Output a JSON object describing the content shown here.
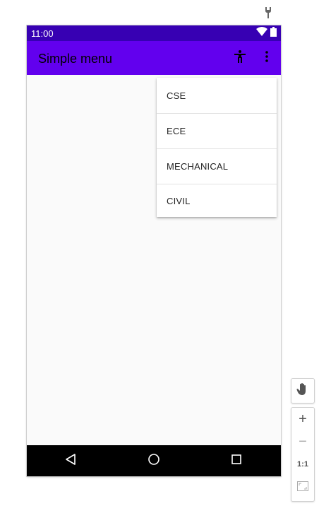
{
  "status_bar": {
    "time": "11:00",
    "wifi_icon": "wifi-icon",
    "battery_icon": "battery-icon"
  },
  "app_bar": {
    "title": "Simple menu",
    "accessibility_icon": "accessibility-icon",
    "overflow_icon": "more-vert-icon"
  },
  "menu": {
    "items": [
      {
        "label": "CSE"
      },
      {
        "label": "ECE"
      },
      {
        "label": "MECHANICAL"
      },
      {
        "label": "CIVIL"
      }
    ]
  },
  "nav_bar": {
    "back_icon": "back-triangle-icon",
    "home_icon": "home-circle-icon",
    "recents_icon": "recents-square-icon"
  },
  "emulator_tools": {
    "wrench_icon": "wrench-icon",
    "pan_icon": "hand-icon",
    "zoom_in_label": "+",
    "zoom_out_label": "−",
    "actual_size_label": "1:1",
    "fit_icon": "fit-screen-icon"
  },
  "colors": {
    "status_bar": "#3700b3",
    "app_bar": "#6200ee",
    "background": "#fafafa",
    "nav_bar": "#000000"
  }
}
